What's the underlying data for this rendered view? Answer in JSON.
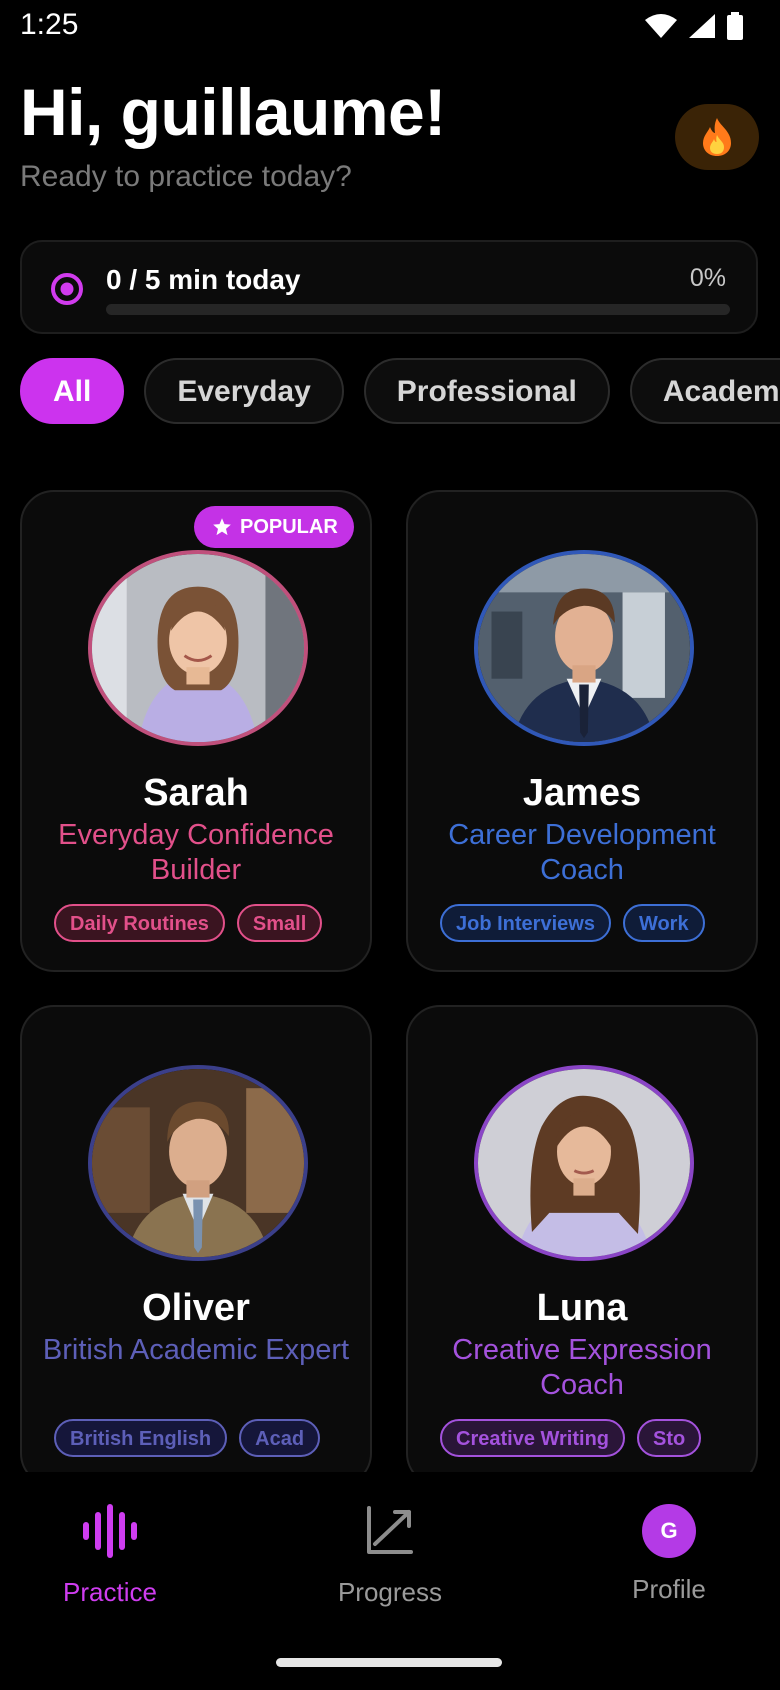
{
  "status_bar": {
    "time": "1:25"
  },
  "header": {
    "greeting": "Hi, guillaume!",
    "subtitle": "Ready to practice today?",
    "streak_icon": "fire-icon"
  },
  "daily_goal": {
    "label": "0 / 5 min today",
    "percent_text": "0%",
    "progress": 0
  },
  "filters": [
    "All",
    "Everyday",
    "Professional",
    "Academic"
  ],
  "active_filter": "All",
  "coaches": [
    {
      "name": "Sarah",
      "role": "Everyday Confidence Builder",
      "tags": [
        "Daily Routines",
        "Small"
      ],
      "badge": "POPULAR",
      "accent": "#e2508a",
      "tag_bg": "#3a1420",
      "ring": "#c0507c"
    },
    {
      "name": "James",
      "role": "Career Development Coach",
      "tags": [
        "Job Interviews",
        "Work"
      ],
      "accent": "#3d6fd6",
      "tag_bg": "#0f1c38",
      "ring": "#3058b8"
    },
    {
      "name": "Oliver",
      "role": "British Academic Expert",
      "tags": [
        "British English",
        "Acad"
      ],
      "accent": "#5d5fb8",
      "tag_bg": "#15163a",
      "ring": "#3b3f8a"
    },
    {
      "name": "Luna",
      "role": "Creative Expression Coach",
      "tags": [
        "Creative Writing",
        "Sto"
      ],
      "accent": "#a452dd",
      "tag_bg": "#2a1538",
      "ring": "#8a45c6"
    }
  ],
  "bottom_nav": {
    "practice": "Practice",
    "progress": "Progress",
    "profile": "Profile",
    "profile_initial": "G",
    "active": "Practice",
    "accent": "#cf3df0"
  }
}
